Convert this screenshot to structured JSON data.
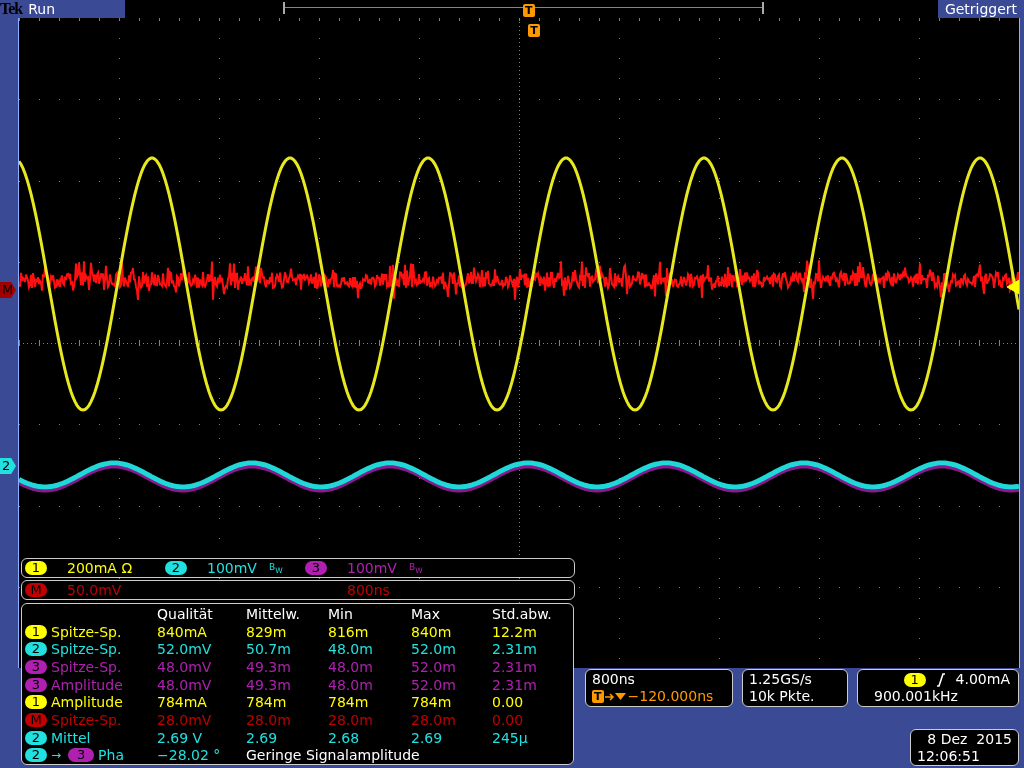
{
  "header": {
    "brand": "Tek",
    "state": "Run",
    "record_marker": "T",
    "status": "Getriggert"
  },
  "graticule": {
    "trigger_marker": "T",
    "markers": [
      {
        "label": "M",
        "color": "#a00000"
      },
      {
        "label": "2",
        "color": "#20e0e0"
      }
    ]
  },
  "vertical": [
    {
      "source": "1",
      "color": "#ffff00",
      "scale": "200mA Ω"
    },
    {
      "source": "2",
      "color": "#20e0e0",
      "scale": "100mV",
      "bandwidth": "B$_{W}$"
    },
    {
      "source": "3",
      "color": "#b020b0",
      "scale": "100mV",
      "bandwidth": "B$_{W}$"
    }
  ],
  "math": {
    "source": "M",
    "color": "#c00000",
    "scale": "50.0mV",
    "timebase": "800ns"
  },
  "measurements": {
    "columns": [
      "Qualität",
      "Mittelw.",
      "Min",
      "Max",
      "Std.abw."
    ],
    "rows": [
      {
        "kind": "stat",
        "source": "1",
        "color": "#ffff00",
        "name": "Spitze-Sp.",
        "values": [
          "840mA",
          "829m",
          "816m",
          "840m",
          "12.2m"
        ]
      },
      {
        "kind": "stat",
        "source": "2",
        "color": "#20e0e0",
        "name": "Spitze-Sp.",
        "values": [
          "52.0mV",
          "50.7m",
          "48.0m",
          "52.0m",
          "2.31m"
        ]
      },
      {
        "kind": "stat",
        "source": "3",
        "color": "#b020b0",
        "name": "Spitze-Sp.",
        "values": [
          "48.0mV",
          "49.3m",
          "48.0m",
          "52.0m",
          "2.31m"
        ]
      },
      {
        "kind": "stat",
        "source": "3",
        "color": "#b020b0",
        "name": "Amplitude",
        "values": [
          "48.0mV",
          "49.3m",
          "48.0m",
          "52.0m",
          "2.31m"
        ]
      },
      {
        "kind": "stat",
        "source": "1",
        "color": "#ffff00",
        "name": "Amplitude",
        "values": [
          "784mA",
          "784m",
          "784m",
          "784m",
          "0.00"
        ]
      },
      {
        "kind": "stat",
        "source": "M",
        "color": "#c00000",
        "name": "Spitze-Sp.",
        "values": [
          "28.0mV",
          "28.0m",
          "28.0m",
          "28.0m",
          "0.00"
        ]
      },
      {
        "kind": "stat",
        "source": "2",
        "color": "#20e0e0",
        "name": "Mittel",
        "values": [
          "2.69 V",
          "2.69",
          "2.68",
          "2.69",
          "245µ"
        ]
      },
      {
        "kind": "phase",
        "source": "2",
        "color": "#20e0e0",
        "target": {
          "source": "3",
          "color": "#b020b0"
        },
        "arrow": "→",
        "name": "Pha",
        "value": "−28.02 °",
        "note": "Geringe Signalamplitude"
      }
    ]
  },
  "horizontal": {
    "scale": "800ns",
    "trigger_badge": "T",
    "delay": "−120.000ns"
  },
  "acquisition": {
    "sample_rate": "1.25GS/s",
    "record_length": "10k Pkte."
  },
  "trigger": {
    "source": "1",
    "color": "#ffff00",
    "threshold": "4.00mA",
    "frequency": "900.001kHz"
  },
  "clock": {
    "date": "8 Dez  2015",
    "time": "12:06:51"
  }
}
